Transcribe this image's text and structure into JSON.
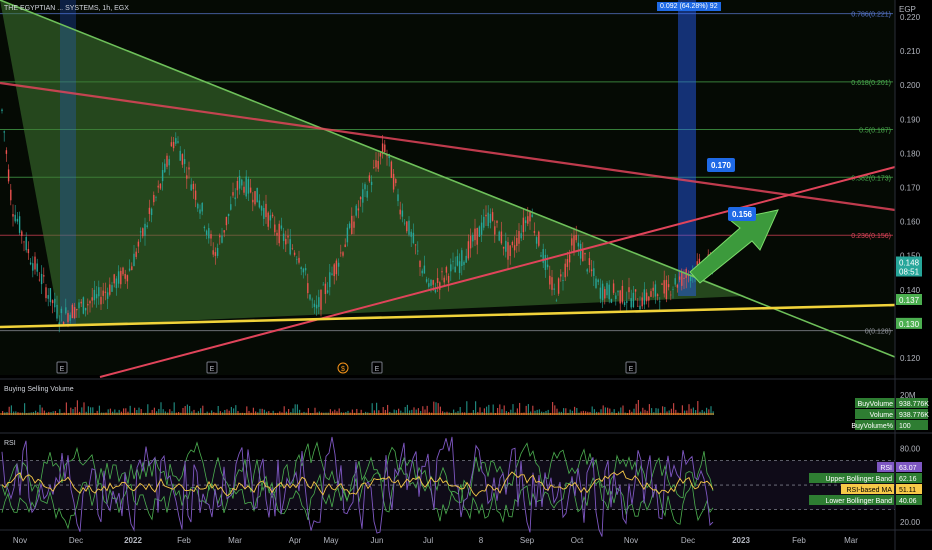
{
  "header": {
    "title": "THE EGYPTIAN ... SYSTEMS, 1h, EGX",
    "overlay_text": "0.092 (64.28%) 92"
  },
  "currency": "EGP",
  "colors": {
    "fill_green": "#3f7a33",
    "line_green": "#6ec05a",
    "line_red": "#e0445a",
    "line_yellow": "#f1d33a",
    "candle_up": "#26a69a",
    "candle_down": "#ef5350",
    "arrow_green": "#3c9a3c",
    "label_blue": "#1f6ae6",
    "fib_green": "#4caf50",
    "fib_red": "#e0445a"
  },
  "chart_data": {
    "type": "line",
    "x_ticks": [
      "Nov",
      "Dec",
      "2022",
      "Feb",
      "Mar",
      "Apr",
      "May",
      "Jun",
      "Jul",
      "8",
      "Sep",
      "Oct",
      "Nov",
      "Dec",
      "2023",
      "Feb",
      "Mar"
    ],
    "price_axis": {
      "ticks": [
        "0.220",
        "0.210",
        "0.200",
        "0.190",
        "0.180",
        "0.170",
        "0.160",
        "0.150",
        "0.140",
        "0.130",
        "0.120"
      ],
      "range": [
        0.115,
        0.225
      ]
    },
    "price_labels": [
      {
        "value": 0.148,
        "text": "0.148",
        "sub": "08:51",
        "color": "#26a69a"
      },
      {
        "value": 0.137,
        "text": "0.137",
        "color": "#4caf50"
      },
      {
        "value": 0.13,
        "text": "0.130",
        "color": "#4caf50"
      }
    ],
    "fib_levels": [
      {
        "value": 0.221,
        "label": "0.786(0.221)"
      },
      {
        "value": 0.201,
        "label": "0.618(0.201)"
      },
      {
        "value": 0.187,
        "label": "0.5(0.187)"
      },
      {
        "value": 0.173,
        "label": "0.382(0.173)"
      },
      {
        "value": 0.156,
        "label": "0.236(0.156)"
      },
      {
        "value": 0.128,
        "label": "0(0.128)"
      }
    ],
    "targets": [
      {
        "value": 0.17,
        "text": "0.170"
      },
      {
        "value": 0.156,
        "text": "0.156"
      }
    ],
    "event_markers": [
      "E",
      "E",
      "$",
      "E",
      "E"
    ],
    "volume_pane": {
      "title": "Buying Selling Volume",
      "axis_label": "20M",
      "labels": [
        {
          "name": "BuyVolume",
          "value": "938.776K"
        },
        {
          "name": "Volume",
          "value": "938.776K"
        },
        {
          "name": "BuyVolume%",
          "value": "100"
        }
      ]
    },
    "rsi_pane": {
      "title": "RSI",
      "ticks": [
        "80.00",
        "20.00"
      ],
      "range": [
        15,
        90
      ],
      "levels": [
        70,
        50,
        30
      ],
      "labels": [
        {
          "name": "RSI",
          "value": "63.07"
        },
        {
          "name": "Upper Bollinger Band",
          "value": "62.16"
        },
        {
          "name": "RSI-based MA",
          "value": "51.11"
        },
        {
          "name": "Lower Bollinger Band",
          "value": "40.06"
        }
      ]
    }
  }
}
